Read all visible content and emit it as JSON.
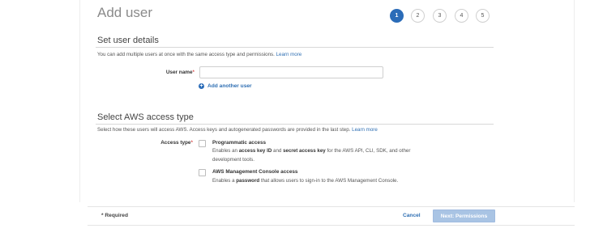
{
  "header": {
    "title": "Add user"
  },
  "steps": [
    {
      "label": "1",
      "active": true
    },
    {
      "label": "2",
      "active": false
    },
    {
      "label": "3",
      "active": false
    },
    {
      "label": "4",
      "active": false
    },
    {
      "label": "5",
      "active": false
    }
  ],
  "user_details": {
    "title": "Set user details",
    "description": "You can add multiple users at once with the same access type and permissions.",
    "learn_more": "Learn more",
    "user_name_label": "User name",
    "required_mark": "*",
    "user_name_value": "",
    "add_another_label": "Add another user",
    "add_icon_glyph": "+"
  },
  "access_type": {
    "title": "Select AWS access type",
    "description": "Select how these users will access AWS. Access keys and autogenerated passwords are provided in the last step.",
    "learn_more": "Learn more",
    "label": "Access type",
    "required_mark": "*",
    "options": [
      {
        "title": "Programmatic access",
        "desc_part1": "Enables an ",
        "desc_bold1": "access key ID",
        "desc_part2": " and ",
        "desc_bold2": "secret access key",
        "desc_part3": " for the AWS API, CLI, SDK, and other development tools.",
        "checked": false
      },
      {
        "title": "AWS Management Console access",
        "desc_part1": "Enables a ",
        "desc_bold1": "password",
        "desc_part2": " that allows users to sign-in to the AWS Management Console.",
        "checked": false
      }
    ]
  },
  "footer": {
    "required_note": "* Required",
    "cancel_label": "Cancel",
    "next_label": "Next: Permissions"
  },
  "colors": {
    "accent": "#2b6cb8",
    "link": "#2f6fb3",
    "disabled_button": "#a9c4e4"
  },
  "icons": {
    "add_user": "plus-circle-icon",
    "checkbox": "checkbox-icon"
  }
}
